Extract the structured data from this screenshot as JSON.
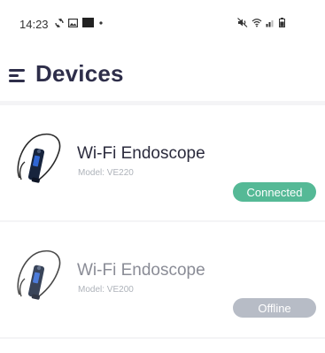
{
  "status_bar": {
    "time": "14:23",
    "icons_left": [
      "sync-icon",
      "gallery-icon",
      "square-icon",
      "dot-icon"
    ],
    "icons_right": [
      "mute-icon",
      "wifi-icon",
      "signal-icon",
      "battery-icon"
    ]
  },
  "header": {
    "title": "Devices",
    "menu_icon": "menu-icon"
  },
  "devices": [
    {
      "name": "Wi-Fi Endoscope",
      "model": "Model: VE220",
      "status": "Connected",
      "status_color": "#55b996"
    },
    {
      "name": "Wi-Fi Endoscope",
      "model": "Model: VE200",
      "status": "Offline",
      "status_color": "#b7bcc6"
    }
  ],
  "colors": {
    "title": "#2e2e4a",
    "list_background": "#f4f4f6",
    "model_text": "#aeb3ba"
  }
}
